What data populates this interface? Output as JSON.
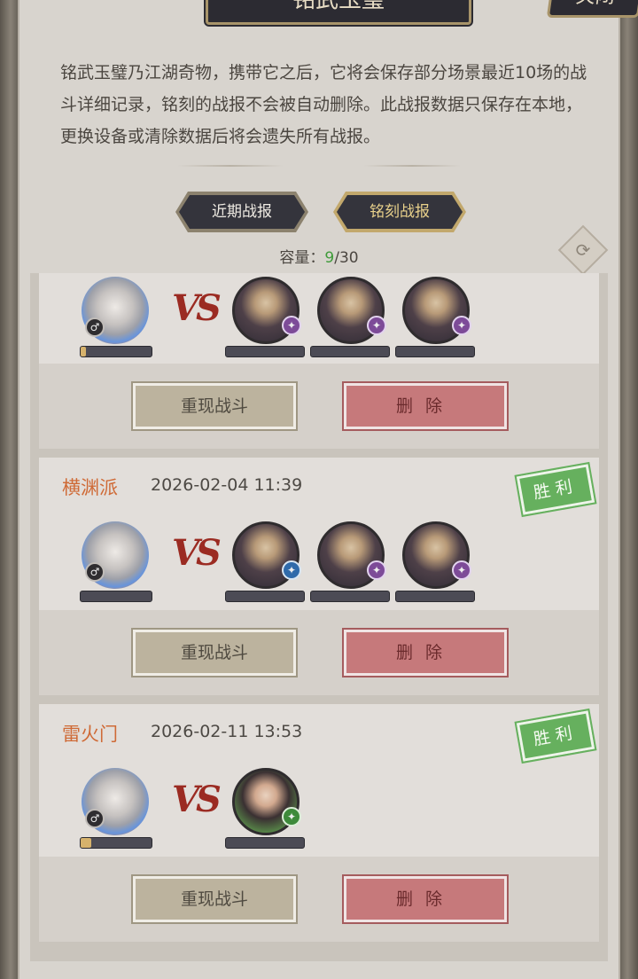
{
  "title": "铭武玉璧",
  "close_label": "关闭",
  "description": "铭武玉璧乃江湖奇物，携带它之后，它将会保存部分场景最近10场的战斗详细记录，铭刻的战报不会被自动删除。此战报数据只保存在本地，更换设备或清除数据后将会遗失所有战报。",
  "tabs": [
    {
      "label": "近期战报"
    },
    {
      "label": "铭刻战报"
    }
  ],
  "capacity": {
    "label": "容量：",
    "used": "9",
    "total": "/30"
  },
  "vs_text": "VS",
  "sync_icon": "refresh-icon",
  "colors": {
    "win_stamp": "#66b05e",
    "sect_name": "#cf6a36",
    "capacity_used": "#3f9b3a"
  },
  "records": [
    {
      "sect": "",
      "time": "",
      "result": "",
      "hero_progress": 0.08,
      "opponents": [
        {
          "badge": "purple"
        },
        {
          "badge": "purple"
        },
        {
          "badge": "purple"
        }
      ],
      "replay_label": "重现战斗",
      "delete_label": "删除"
    },
    {
      "sect": "横渊派",
      "time": "2026-02-04 11:39",
      "result": "胜利",
      "hero_progress": 0.0,
      "opponents": [
        {
          "badge": "blue"
        },
        {
          "badge": "purple"
        },
        {
          "badge": "purple"
        }
      ],
      "replay_label": "重现战斗",
      "delete_label": "删除"
    },
    {
      "sect": "雷火门",
      "time": "2026-02-11 13:53",
      "result": "胜利",
      "hero_progress": 0.15,
      "opponents": [
        {
          "badge": "green"
        }
      ],
      "replay_label": "重现战斗",
      "delete_label": "删除"
    }
  ]
}
